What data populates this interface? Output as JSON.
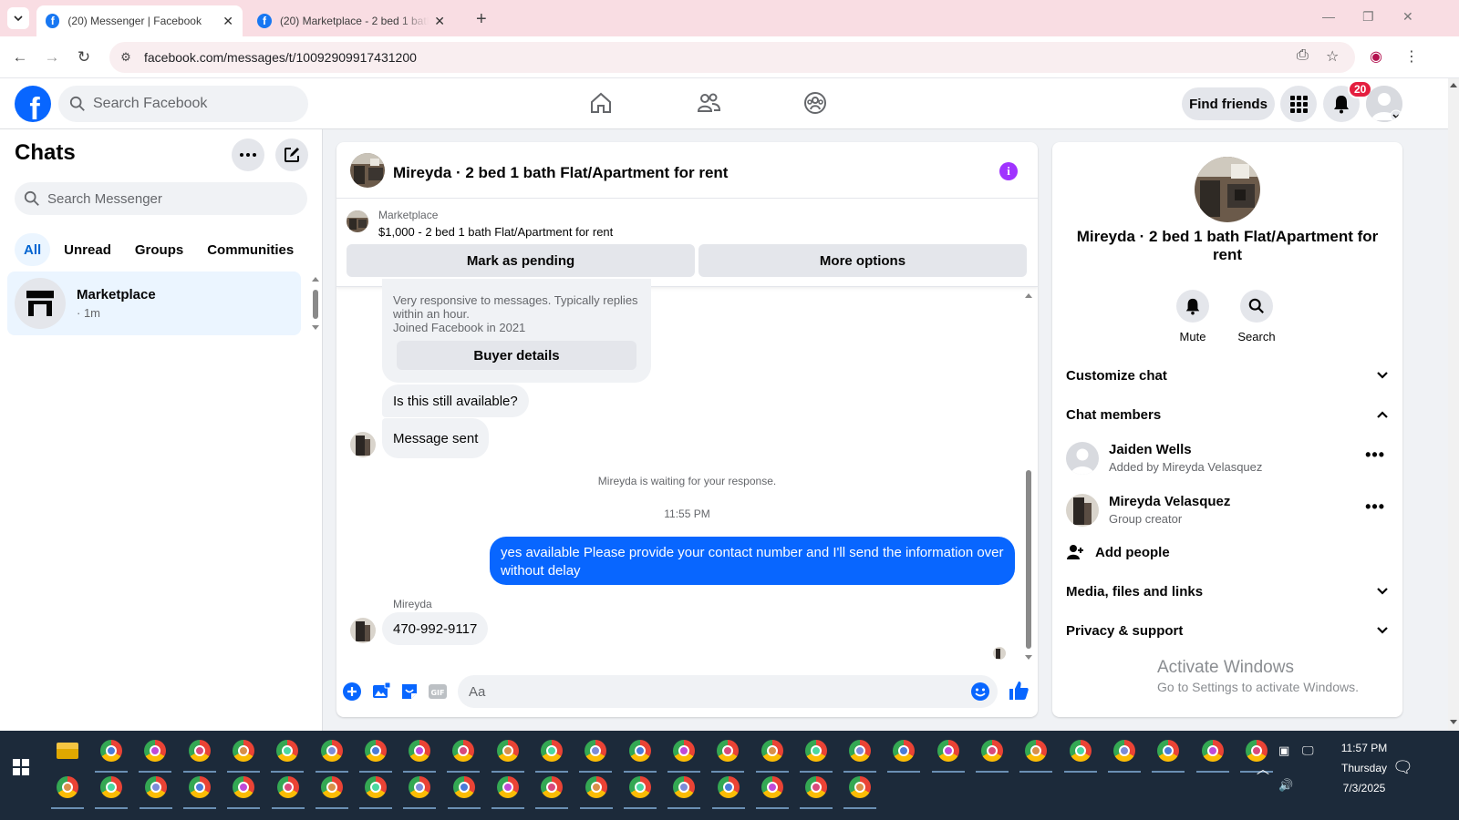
{
  "browser": {
    "tabs": [
      {
        "title": "(20) Messenger | Facebook",
        "active": true
      },
      {
        "title": "(20) Marketplace - 2 bed 1 bath",
        "active": false
      }
    ],
    "url": "facebook.com/messages/t/10092909917431200"
  },
  "fb_header": {
    "search_placeholder": "Search Facebook",
    "find_friends": "Find friends",
    "notification_count": "20"
  },
  "chats": {
    "title": "Chats",
    "search_placeholder": "Search Messenger",
    "filters": [
      "All",
      "Unread",
      "Groups",
      "Communities"
    ],
    "active_filter": "All",
    "items": [
      {
        "name": "Marketplace",
        "time": "· 1m"
      }
    ]
  },
  "conversation": {
    "title": "Mireyda · 2 bed 1 bath Flat/Apartment for rent",
    "marketplace_label": "Marketplace",
    "listing": "$1,000 - 2 bed 1 bath Flat/Apartment for rent",
    "mark_pending": "Mark as pending",
    "more_options": "More options",
    "seller_info_1": "Very responsive to messages. Typically replies within an hour.",
    "seller_info_2": "Joined Facebook in 2021",
    "buyer_details": "Buyer details",
    "msg_available": "Is this still available?",
    "msg_sent": "Message sent",
    "waiting": "Mireyda is waiting for your response.",
    "timestamp": "11:55 PM",
    "outgoing": "yes available Please provide your contact number and I'll send the information over without delay",
    "sender_name": "Mireyda",
    "incoming_phone": "470-992-9117",
    "composer_placeholder": "Aa"
  },
  "info_panel": {
    "name": "Mireyda · 2 bed 1 bath Flat/Apartment for rent",
    "mute": "Mute",
    "search": "Search",
    "customize": "Customize chat",
    "members_title": "Chat members",
    "members": [
      {
        "name": "Jaiden Wells",
        "sub": "Added by Mireyda Velasquez"
      },
      {
        "name": "Mireyda Velasquez",
        "sub": "Group creator"
      }
    ],
    "add_people": "Add people",
    "media": "Media, files and links",
    "privacy": "Privacy & support"
  },
  "watermark": {
    "line1": "Activate Windows",
    "line2": "Go to Settings to activate Windows."
  },
  "taskbar": {
    "time": "11:57 PM",
    "day": "Thursday",
    "date": "7/3/2025"
  },
  "colors": {
    "fb_blue": "#0866ff",
    "tab_bar": "#f9dde3",
    "taskbar": "#1c2a3a",
    "badge_red": "#e41e3f",
    "info_purple": "#a033ff"
  }
}
